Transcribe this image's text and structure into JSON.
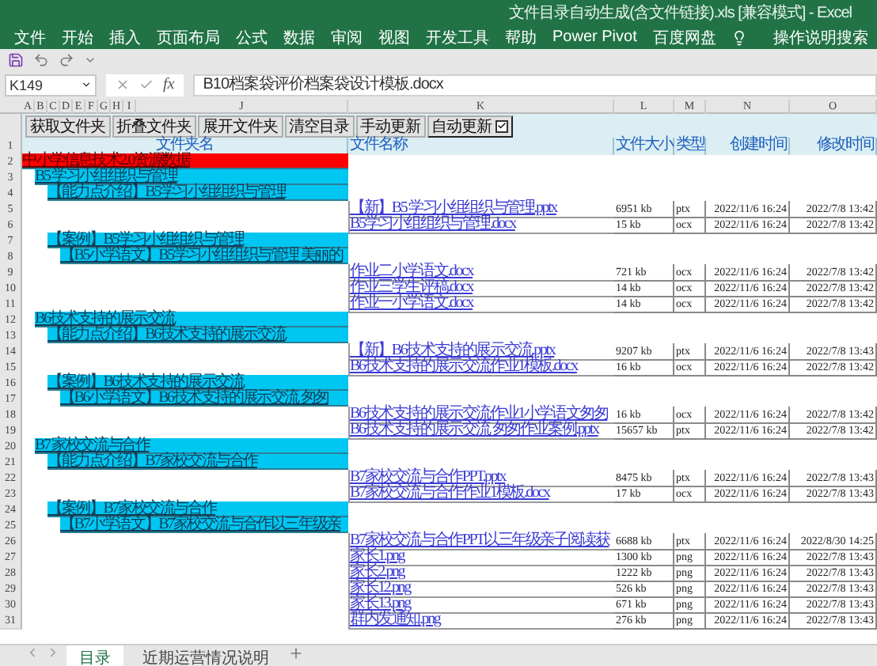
{
  "window": {
    "title": "文件目录自动生成(含文件链接).xls  [兼容模式]  -  Excel"
  },
  "ribbon_tabs": [
    "文件",
    "开始",
    "插入",
    "页面布局",
    "公式",
    "数据",
    "审阅",
    "视图",
    "开发工具",
    "帮助",
    "Power Pivot",
    "百度网盘"
  ],
  "tell_me": "操作说明搜索",
  "formula_bar": {
    "name_box": "K149",
    "function_label": "fx",
    "formula": "B10档案袋评价档案袋设计模板.docx"
  },
  "columns": [
    "A",
    "B",
    "C",
    "D",
    "E",
    "F",
    "G",
    "H",
    "I",
    "J",
    "K",
    "L",
    "M",
    "N",
    "O"
  ],
  "sheet_buttons": [
    {
      "kind": "button",
      "label": "获取文件夹"
    },
    {
      "kind": "button",
      "label": "折叠文件夹"
    },
    {
      "kind": "button",
      "label": "展开文件夹"
    },
    {
      "kind": "button",
      "label": "清空目录"
    },
    {
      "kind": "button",
      "label": "手动更新"
    },
    {
      "kind": "checkbox",
      "label": "自动更新",
      "checked": true
    }
  ],
  "header": {
    "row": "1",
    "cells": [
      "文件夹名",
      "文件名称",
      "文件大小",
      "类型",
      "创建时间",
      "修改时间"
    ]
  },
  "tree": [
    {
      "row": "2",
      "name": "中小学信息技术2.0资源数据",
      "children": [
        {
          "row": "3",
          "name": "B5 学习小组组织与管理",
          "children": [
            {
              "row": "4",
              "name": "【能力点介绍】B5学习小组组织与管理",
              "files": [
                {
                  "row": "5",
                  "name": "【新】B5 学习小组组织与管理.pptx",
                  "size": "6951 kb",
                  "type": "ptx",
                  "created": "2022/11/6 16:24",
                  "modified": "2022/7/8 13:42"
                },
                {
                  "row": "6",
                  "name": "B5学习小组组织与管理.docx",
                  "size": "15 kb",
                  "type": "ocx",
                  "created": "2022/11/6 16:24",
                  "modified": "2022/7/8 13:42"
                }
              ]
            },
            {
              "row": "7",
              "name": "【案例】B5学习小组组织与管理",
              "children": [
                {
                  "row": "8",
                  "name": "【B5小学语文】B5学习小组组织与管理 美丽的",
                  "files": [
                    {
                      "row": "9",
                      "name": "作业二小学语文.docx",
                      "size": "721 kb",
                      "type": "ocx",
                      "created": "2022/11/6 16:24",
                      "modified": "2022/7/8 13:42"
                    },
                    {
                      "row": "10",
                      "name": "作业三学生评稿.docx",
                      "size": "14 kb",
                      "type": "ocx",
                      "created": "2022/11/6 16:24",
                      "modified": "2022/7/8 13:42"
                    },
                    {
                      "row": "11",
                      "name": "作业一小学语文.docx",
                      "size": "14 kb",
                      "type": "ocx",
                      "created": "2022/11/6 16:24",
                      "modified": "2022/7/8 13:42"
                    }
                  ]
                }
              ]
            }
          ]
        },
        {
          "row": "12",
          "name": "B6技术支持的展示交流",
          "children": [
            {
              "row": "13",
              "name": "【能力点介绍】B6技术支持的展示交流",
              "files": [
                {
                  "row": "14",
                  "name": "【新】B6技术支持的展示交流.pptx",
                  "size": "9207 kb",
                  "type": "ptx",
                  "created": "2022/11/6 16:24",
                  "modified": "2022/7/8 13:43"
                },
                {
                  "row": "15",
                  "name": "B6技术支持的展示交流作业1模板.docx",
                  "size": "16 kb",
                  "type": "ocx",
                  "created": "2022/11/6 16:24",
                  "modified": "2022/7/8 13:42"
                }
              ]
            },
            {
              "row": "16",
              "name": "【案例】B6技术支持的展示交流",
              "children": [
                {
                  "row": "17",
                  "name": "【B6小学语文】B6技术支持的展示交流 匆匆",
                  "files": [
                    {
                      "row": "18",
                      "name": "B6技术支持的展示交流作业1小学语文匆匆",
                      "size": "16 kb",
                      "type": "ocx",
                      "created": "2022/11/6 16:24",
                      "modified": "2022/7/8 13:42"
                    },
                    {
                      "row": "19",
                      "name": "B6技术支持的展示交流 匆匆作业案例.pptx",
                      "size": "15657 kb",
                      "type": "ptx",
                      "created": "2022/11/6 16:24",
                      "modified": "2022/7/8 13:42"
                    }
                  ]
                }
              ]
            }
          ]
        },
        {
          "row": "20",
          "name": "B7 家校交流与合作",
          "children": [
            {
              "row": "21",
              "name": "【能力点介绍】B7家校交流与合作",
              "files": [
                {
                  "row": "22",
                  "name": "B7家校交流与合作PPT.pptx",
                  "size": "8475 kb",
                  "type": "ptx",
                  "created": "2022/11/6 16:24",
                  "modified": "2022/7/8 13:43"
                },
                {
                  "row": "23",
                  "name": "B7家校交流与合作作业1模板.docx",
                  "size": "17 kb",
                  "type": "ocx",
                  "created": "2022/11/6 16:24",
                  "modified": "2022/7/8 13:43"
                }
              ]
            },
            {
              "row": "24",
              "name": "【案例】B7家校交流与合作",
              "children": [
                {
                  "row": "25",
                  "name": "【B7小学语文】B7家校交流与合作以三年级亲",
                  "files": [
                    {
                      "row": "26",
                      "name": "B7家校交流与合作PPT以三年级亲子阅读获",
                      "size": "6688 kb",
                      "type": "ptx",
                      "created": "2022/11/6 16:24",
                      "modified": "2022/8/30 14:25"
                    },
                    {
                      "row": "27",
                      "name": "家长1.png",
                      "size": "1300 kb",
                      "type": "png",
                      "created": "2022/11/6 16:24",
                      "modified": "2022/7/8 13:43"
                    },
                    {
                      "row": "28",
                      "name": "家长2.png",
                      "size": "1222 kb",
                      "type": "png",
                      "created": "2022/11/6 16:24",
                      "modified": "2022/7/8 13:43"
                    },
                    {
                      "row": "29",
                      "name": "家长12.png",
                      "size": "526 kb",
                      "type": "png",
                      "created": "2022/11/6 16:24",
                      "modified": "2022/7/8 13:43"
                    },
                    {
                      "row": "30",
                      "name": "家长13.png",
                      "size": "671 kb",
                      "type": "png",
                      "created": "2022/11/6 16:24",
                      "modified": "2022/7/8 13:43"
                    },
                    {
                      "row": "31",
                      "name": "群内发通知.png",
                      "size": "276 kb",
                      "type": "png",
                      "created": "2022/11/6 16:24",
                      "modified": "2022/7/8 13:43"
                    }
                  ]
                }
              ]
            }
          ]
        }
      ]
    }
  ],
  "sheet_tabs": [
    {
      "label": "目录",
      "selected": true
    },
    {
      "label": "近期运营情况说明",
      "selected": false
    }
  ]
}
